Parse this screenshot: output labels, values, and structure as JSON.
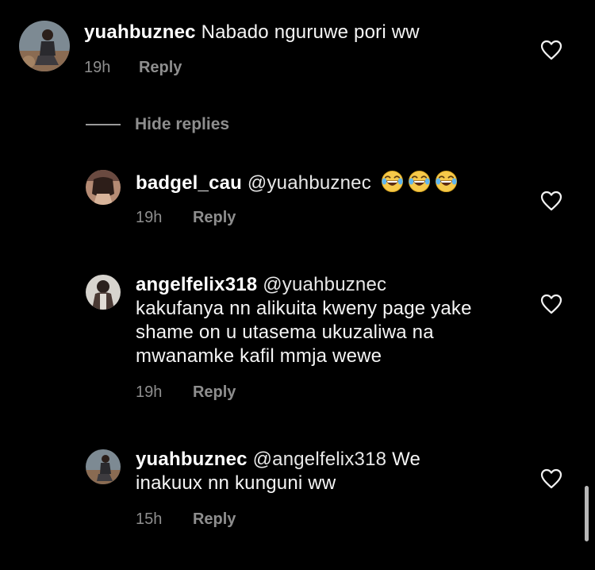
{
  "comments": [
    {
      "username": "yuahbuznec",
      "mention": "",
      "text": "Nabado nguruwe pori ww",
      "time": "19h",
      "reply_label": "Reply"
    }
  ],
  "hide_replies": {
    "label": "Hide replies"
  },
  "replies": [
    {
      "username": "badgel_cau",
      "mention": "@yuahbuznec",
      "emoji": "face-with-tears-of-joy",
      "emoji_count": 3,
      "time": "19h",
      "reply_label": "Reply"
    },
    {
      "username": "angelfelix318",
      "mention": "@yuahbuznec",
      "lines": [
        "kakufanya nn alikuita kweny page yake",
        "shame on u utasema ukuzaliwa na",
        "mwanamke kafil mmja wewe"
      ],
      "time": "19h",
      "reply_label": "Reply"
    },
    {
      "username": "yuahbuznec",
      "mention": "@angelfelix318",
      "text_after_mention": "We",
      "line2": "inakuux nn kunguni ww",
      "time": "15h",
      "reply_label": "Reply"
    }
  ],
  "icons": {
    "like": "heart-outline-icon",
    "emoji": "face-with-tears-of-joy"
  },
  "colors": {
    "background": "#000000",
    "primary_text": "#ffffff",
    "secondary_text": "#8e8e8e"
  }
}
